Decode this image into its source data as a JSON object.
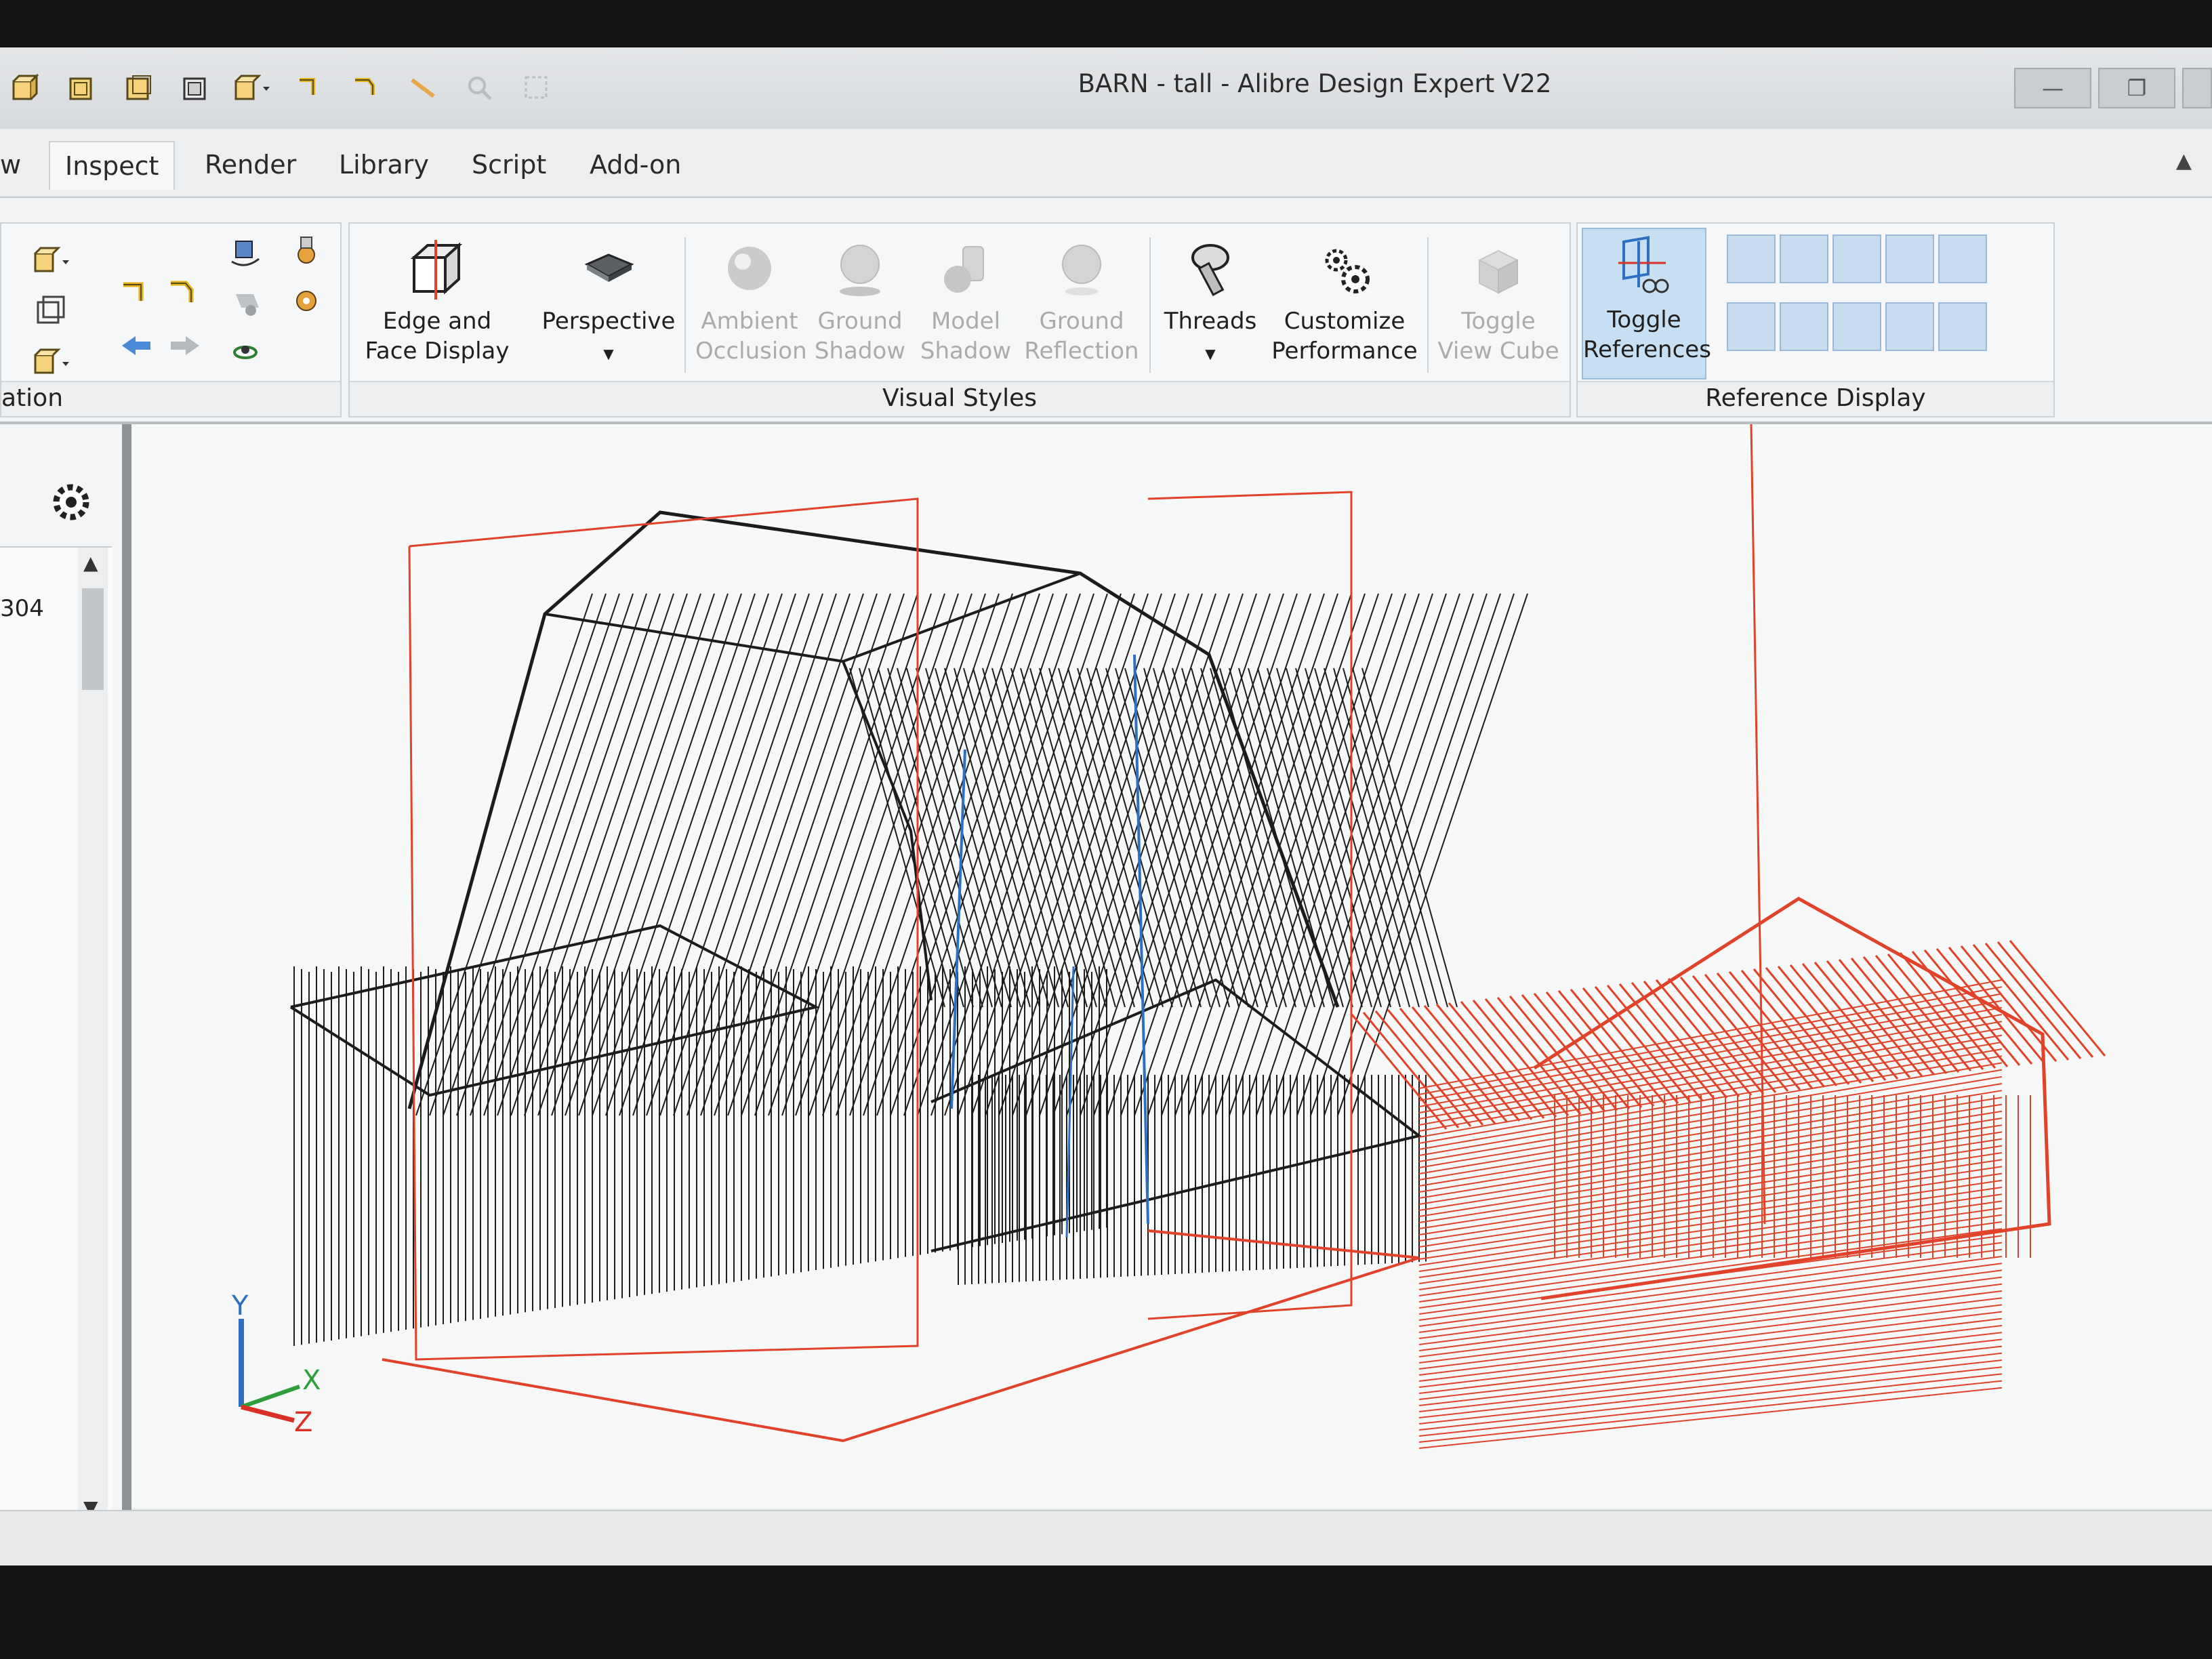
{
  "window": {
    "title": "BARN - tall - Alibre Design Expert V22"
  },
  "tabs": [
    {
      "label": "w"
    },
    {
      "label": "Inspect"
    },
    {
      "label": "Render"
    },
    {
      "label": "Library"
    },
    {
      "label": "Script"
    },
    {
      "label": "Add-on"
    }
  ],
  "ribbon": {
    "navigation": {
      "label_fragment": "ation"
    },
    "visual_styles": {
      "label": "Visual Styles",
      "buttons": {
        "edge_face_line1": "Edge and",
        "edge_face_line2": "Face Display",
        "perspective": "Perspective",
        "ambient_line1": "Ambient",
        "ambient_line2": "Occlusion",
        "ground_shadow_line1": "Ground",
        "ground_shadow_line2": "Shadow",
        "model_shadow_line1": "Model",
        "model_shadow_line2": "Shadow",
        "ground_reflection_line1": "Ground",
        "ground_reflection_line2": "Reflection",
        "threads": "Threads",
        "customize_line1": "Customize",
        "customize_line2": "Performance",
        "toggle_cube_line1": "Toggle",
        "toggle_cube_line2": "View Cube"
      }
    },
    "reference_display": {
      "label": "Reference Display",
      "toggle_line1": "Toggle",
      "toggle_line2": "References"
    }
  },
  "left_panel": {
    "value": "304"
  },
  "triad": {
    "x": "X",
    "y": "Y",
    "z": "Z"
  },
  "colors": {
    "accent_blue": "#2f6fc2",
    "model_black": "#1c1c1c",
    "model_red": "#e0432a",
    "gear_orange": "#e89a2c"
  },
  "icons": [
    "cube-icon",
    "undo-icon",
    "redo-icon",
    "pencil-icon",
    "zoom-icon",
    "gear-icon",
    "threads-bolt-icon",
    "view-cube-icon",
    "toggle-references-icon"
  ]
}
